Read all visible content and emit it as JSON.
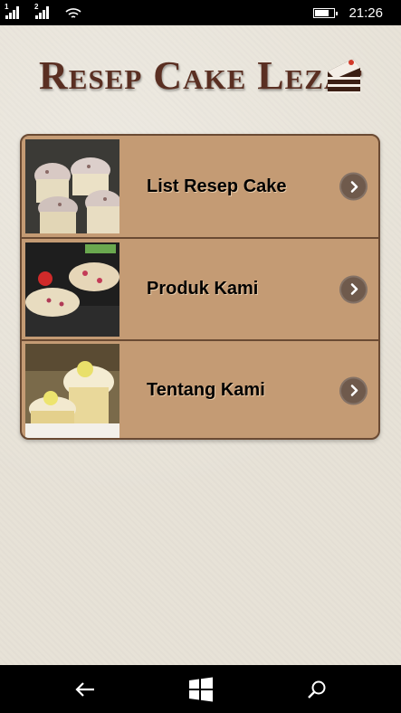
{
  "status": {
    "time": "21:26",
    "sim1": "1",
    "sim2": "2",
    "battery_level": 0.75
  },
  "app": {
    "title": "Resep Cake Lezat",
    "menu": [
      {
        "label": "List Resep Cake",
        "thumbnail": "cupcakes-photo"
      },
      {
        "label": "Produk Kami",
        "thumbnail": "muffin-tray-photo"
      },
      {
        "label": "Tentang Kami",
        "thumbnail": "lemon-cupcake-photo"
      }
    ]
  },
  "icons": {
    "arrow": "chevron-right-icon",
    "back": "back-arrow-icon",
    "start": "windows-start-icon",
    "search": "search-icon",
    "cake": "cake-slice-icon"
  },
  "colors": {
    "menu_bg": "#c49b74",
    "menu_border": "#6a4a33",
    "title": "#5a2f22",
    "arrow_button": "#6f5a4c"
  }
}
